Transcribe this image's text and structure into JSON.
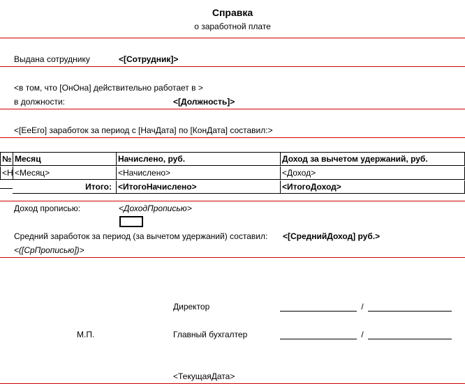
{
  "title": "Справка",
  "subtitle": "о заработной плате",
  "issued_to_label": "Выдана сотруднику",
  "issued_to_value": "<[Сотрудник]>",
  "works_line": "<в том, что [ОнОна] действительно работает в >",
  "position_label": "в должности:",
  "position_value": "<[Должность]>",
  "earnings_line": "<[ЕеЕго] заработок за период с [НачДата] по  [КонДата] составил:>",
  "table": {
    "headers": {
      "num": "№",
      "month": "Месяц",
      "accrued": "Начислено, руб.",
      "income": "Доход за вычетом удержаний, руб."
    },
    "row": {
      "num": "<Ном",
      "month": "<Месяц>",
      "accrued": "<Начислено>",
      "income": "<Доход>"
    },
    "total_label": "Итого:",
    "total_accrued": "<ИтогоНачислено>",
    "total_income": "<ИтогоДоход>"
  },
  "income_words_label": "Доход прописью:",
  "income_words_value": "<ДоходПрописью>",
  "avg_label": "Средний заработок за период (за вычетом удержаний) составил:",
  "avg_value": "<[СреднийДоход] руб.>",
  "avg_words": "<([СрПрописью])>",
  "mp": "М.П.",
  "director": "Директор",
  "accountant": "Главный бухгалтер",
  "date": "<ТекущаяДата>",
  "slash": "/"
}
